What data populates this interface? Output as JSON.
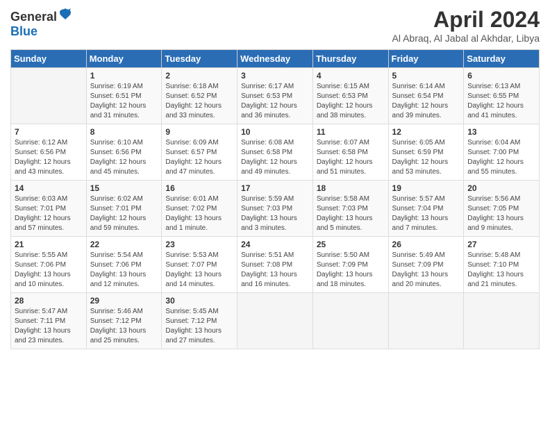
{
  "header": {
    "logo_general": "General",
    "logo_blue": "Blue",
    "month_title": "April 2024",
    "subtitle": "Al Abraq, Al Jabal al Akhdar, Libya"
  },
  "weekdays": [
    "Sunday",
    "Monday",
    "Tuesday",
    "Wednesday",
    "Thursday",
    "Friday",
    "Saturday"
  ],
  "weeks": [
    [
      {
        "day": "",
        "info": ""
      },
      {
        "day": "1",
        "info": "Sunrise: 6:19 AM\nSunset: 6:51 PM\nDaylight: 12 hours\nand 31 minutes."
      },
      {
        "day": "2",
        "info": "Sunrise: 6:18 AM\nSunset: 6:52 PM\nDaylight: 12 hours\nand 33 minutes."
      },
      {
        "day": "3",
        "info": "Sunrise: 6:17 AM\nSunset: 6:53 PM\nDaylight: 12 hours\nand 36 minutes."
      },
      {
        "day": "4",
        "info": "Sunrise: 6:15 AM\nSunset: 6:53 PM\nDaylight: 12 hours\nand 38 minutes."
      },
      {
        "day": "5",
        "info": "Sunrise: 6:14 AM\nSunset: 6:54 PM\nDaylight: 12 hours\nand 39 minutes."
      },
      {
        "day": "6",
        "info": "Sunrise: 6:13 AM\nSunset: 6:55 PM\nDaylight: 12 hours\nand 41 minutes."
      }
    ],
    [
      {
        "day": "7",
        "info": "Sunrise: 6:12 AM\nSunset: 6:56 PM\nDaylight: 12 hours\nand 43 minutes."
      },
      {
        "day": "8",
        "info": "Sunrise: 6:10 AM\nSunset: 6:56 PM\nDaylight: 12 hours\nand 45 minutes."
      },
      {
        "day": "9",
        "info": "Sunrise: 6:09 AM\nSunset: 6:57 PM\nDaylight: 12 hours\nand 47 minutes."
      },
      {
        "day": "10",
        "info": "Sunrise: 6:08 AM\nSunset: 6:58 PM\nDaylight: 12 hours\nand 49 minutes."
      },
      {
        "day": "11",
        "info": "Sunrise: 6:07 AM\nSunset: 6:58 PM\nDaylight: 12 hours\nand 51 minutes."
      },
      {
        "day": "12",
        "info": "Sunrise: 6:05 AM\nSunset: 6:59 PM\nDaylight: 12 hours\nand 53 minutes."
      },
      {
        "day": "13",
        "info": "Sunrise: 6:04 AM\nSunset: 7:00 PM\nDaylight: 12 hours\nand 55 minutes."
      }
    ],
    [
      {
        "day": "14",
        "info": "Sunrise: 6:03 AM\nSunset: 7:01 PM\nDaylight: 12 hours\nand 57 minutes."
      },
      {
        "day": "15",
        "info": "Sunrise: 6:02 AM\nSunset: 7:01 PM\nDaylight: 12 hours\nand 59 minutes."
      },
      {
        "day": "16",
        "info": "Sunrise: 6:01 AM\nSunset: 7:02 PM\nDaylight: 13 hours\nand 1 minute."
      },
      {
        "day": "17",
        "info": "Sunrise: 5:59 AM\nSunset: 7:03 PM\nDaylight: 13 hours\nand 3 minutes."
      },
      {
        "day": "18",
        "info": "Sunrise: 5:58 AM\nSunset: 7:03 PM\nDaylight: 13 hours\nand 5 minutes."
      },
      {
        "day": "19",
        "info": "Sunrise: 5:57 AM\nSunset: 7:04 PM\nDaylight: 13 hours\nand 7 minutes."
      },
      {
        "day": "20",
        "info": "Sunrise: 5:56 AM\nSunset: 7:05 PM\nDaylight: 13 hours\nand 9 minutes."
      }
    ],
    [
      {
        "day": "21",
        "info": "Sunrise: 5:55 AM\nSunset: 7:06 PM\nDaylight: 13 hours\nand 10 minutes."
      },
      {
        "day": "22",
        "info": "Sunrise: 5:54 AM\nSunset: 7:06 PM\nDaylight: 13 hours\nand 12 minutes."
      },
      {
        "day": "23",
        "info": "Sunrise: 5:53 AM\nSunset: 7:07 PM\nDaylight: 13 hours\nand 14 minutes."
      },
      {
        "day": "24",
        "info": "Sunrise: 5:51 AM\nSunset: 7:08 PM\nDaylight: 13 hours\nand 16 minutes."
      },
      {
        "day": "25",
        "info": "Sunrise: 5:50 AM\nSunset: 7:09 PM\nDaylight: 13 hours\nand 18 minutes."
      },
      {
        "day": "26",
        "info": "Sunrise: 5:49 AM\nSunset: 7:09 PM\nDaylight: 13 hours\nand 20 minutes."
      },
      {
        "day": "27",
        "info": "Sunrise: 5:48 AM\nSunset: 7:10 PM\nDaylight: 13 hours\nand 21 minutes."
      }
    ],
    [
      {
        "day": "28",
        "info": "Sunrise: 5:47 AM\nSunset: 7:11 PM\nDaylight: 13 hours\nand 23 minutes."
      },
      {
        "day": "29",
        "info": "Sunrise: 5:46 AM\nSunset: 7:12 PM\nDaylight: 13 hours\nand 25 minutes."
      },
      {
        "day": "30",
        "info": "Sunrise: 5:45 AM\nSunset: 7:12 PM\nDaylight: 13 hours\nand 27 minutes."
      },
      {
        "day": "",
        "info": ""
      },
      {
        "day": "",
        "info": ""
      },
      {
        "day": "",
        "info": ""
      },
      {
        "day": "",
        "info": ""
      }
    ]
  ]
}
